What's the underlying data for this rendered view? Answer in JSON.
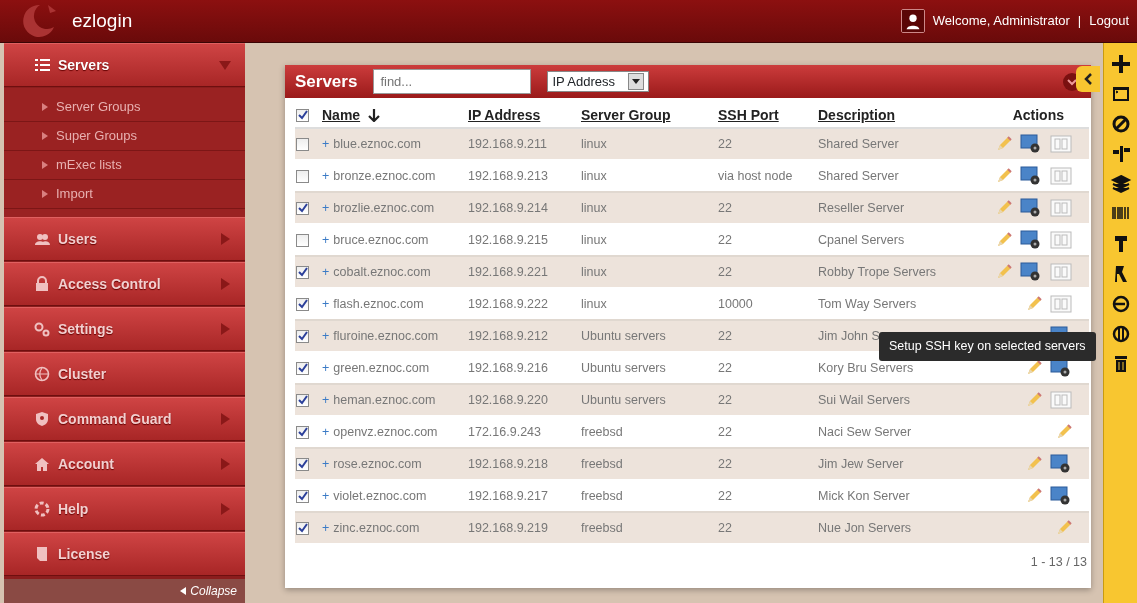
{
  "app": {
    "title": "ezlogin"
  },
  "user": {
    "welcome": "Welcome, Administrator",
    "separator": "|",
    "logout": "Logout"
  },
  "sidebar": {
    "items": [
      {
        "label": "Servers",
        "submenu": true,
        "expanded": true,
        "children": [
          {
            "label": "Server Groups"
          },
          {
            "label": "Super Groups"
          },
          {
            "label": "mExec lists"
          },
          {
            "label": "Import"
          }
        ]
      },
      {
        "label": "Users",
        "submenu": true,
        "expanded": false
      },
      {
        "label": "Access Control",
        "submenu": true,
        "expanded": false
      },
      {
        "label": "Settings",
        "submenu": true,
        "expanded": false
      },
      {
        "label": "Cluster",
        "submenu": false,
        "expanded": false
      },
      {
        "label": "Command Guard",
        "submenu": true,
        "expanded": false
      },
      {
        "label": "Account",
        "submenu": true,
        "expanded": false
      },
      {
        "label": "Help",
        "submenu": true,
        "expanded": false
      },
      {
        "label": "License",
        "submenu": false,
        "expanded": false
      }
    ],
    "collapse": "Collapse"
  },
  "panel": {
    "title": "Servers",
    "search": {
      "placeholder": "find..."
    },
    "filter": {
      "value": "IP Address"
    }
  },
  "table": {
    "all_checked": true,
    "columns": [
      {
        "label": "Name",
        "sortable": true,
        "sorted": true
      },
      {
        "label": "IP Address",
        "sortable": true,
        "sorted": false
      },
      {
        "label": "Server Group",
        "sortable": true,
        "sorted": false
      },
      {
        "label": "SSH Port",
        "sortable": true,
        "sorted": false
      },
      {
        "label": "Description",
        "sortable": true,
        "sorted": false
      },
      {
        "label": "Actions",
        "sortable": false,
        "sorted": false
      }
    ],
    "rows": [
      {
        "checked": false,
        "expander": "+",
        "name": "blue.eznoc.com",
        "ip": "192.168.9.211",
        "group": "linux",
        "port": "22",
        "description": "Shared Server",
        "actions": {
          "edit": true,
          "ssh": true,
          "console": true
        }
      },
      {
        "checked": false,
        "expander": "+",
        "name": "bronze.eznoc.com",
        "ip": "192.168.9.213",
        "group": "linux",
        "port": "via host node",
        "description": "Shared Server",
        "actions": {
          "edit": true,
          "ssh": true,
          "console": true
        }
      },
      {
        "checked": true,
        "expander": "+",
        "name": "brozlie.eznoc.com",
        "ip": "192.168.9.214",
        "group": "linux",
        "port": "22",
        "description": "Reseller Server",
        "actions": {
          "edit": true,
          "ssh": true,
          "console": true
        }
      },
      {
        "checked": false,
        "expander": "+",
        "name": "bruce.eznoc.com",
        "ip": "192.168.9.215",
        "group": "linux",
        "port": "22",
        "description": "Cpanel Servers",
        "actions": {
          "edit": true,
          "ssh": true,
          "console": true
        }
      },
      {
        "checked": true,
        "expander": "+",
        "name": "cobalt.eznoc.com",
        "ip": "192.168.9.221",
        "group": "linux",
        "port": "22",
        "description": "Robby Trope Servers",
        "actions": {
          "edit": true,
          "ssh": true,
          "console": true
        }
      },
      {
        "checked": true,
        "expander": "+",
        "name": "flash.eznoc.com",
        "ip": "192.168.9.222",
        "group": "linux",
        "port": "10000",
        "description": "Tom Way Servers",
        "actions": {
          "edit": true,
          "ssh": false,
          "console": true
        }
      },
      {
        "checked": true,
        "expander": "+",
        "name": "fluroine.eznoc.com",
        "ip": "192.168.9.212",
        "group": "Ubuntu servers",
        "port": "22",
        "description": "Jim John S",
        "actions": {
          "edit": false,
          "ssh": true,
          "console": false
        }
      },
      {
        "checked": true,
        "expander": "+",
        "name": "green.eznoc.com",
        "ip": "192.168.9.216",
        "group": "Ubuntu servers",
        "port": "22",
        "description": "Kory Bru Servers",
        "actions": {
          "edit": true,
          "ssh": true,
          "console": false
        }
      },
      {
        "checked": true,
        "expander": "+",
        "name": "heman.eznoc.com",
        "ip": "192.168.9.220",
        "group": "Ubuntu servers",
        "port": "22",
        "description": "Sui Wail Servers",
        "actions": {
          "edit": true,
          "ssh": false,
          "console": true
        }
      },
      {
        "checked": true,
        "expander": "+",
        "name": "openvz.eznoc.com",
        "ip": "172.16.9.243",
        "group": "freebsd",
        "port": "22",
        "description": "Naci Sew Server",
        "actions": {
          "edit": true,
          "ssh": false,
          "console": false
        }
      },
      {
        "checked": true,
        "expander": "+",
        "name": "rose.eznoc.com",
        "ip": "192.168.9.218",
        "group": "freebsd",
        "port": "22",
        "description": "Jim Jew Server",
        "actions": {
          "edit": true,
          "ssh": true,
          "console": false
        }
      },
      {
        "checked": true,
        "expander": "+",
        "name": "violet.eznoc.com",
        "ip": "192.168.9.217",
        "group": "freebsd",
        "port": "22",
        "description": "Mick Kon Server",
        "actions": {
          "edit": true,
          "ssh": true,
          "console": false
        }
      },
      {
        "checked": true,
        "expander": "+",
        "name": "zinc.eznoc.com",
        "ip": "192.168.9.219",
        "group": "freebsd",
        "port": "22",
        "description": "Nue Jon Servers",
        "actions": {
          "edit": true,
          "ssh": false,
          "console": false
        }
      }
    ]
  },
  "pager": "1 - 13 / 13",
  "tooltip": "Setup SSH key on selected servers"
}
